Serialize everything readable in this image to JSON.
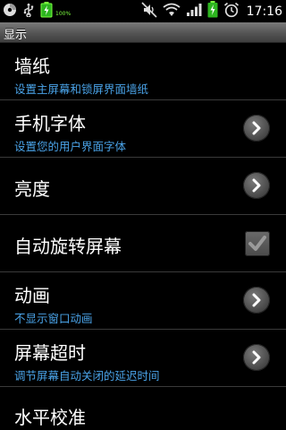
{
  "status_bar": {
    "icons": [
      "disc-icon",
      "usb-icon",
      "battery-charge-icon",
      "mute-icon",
      "wifi-icon",
      "signal-icon",
      "battery-icon",
      "alarm-icon"
    ],
    "battery_label": "100%",
    "time": "17:16"
  },
  "title_bar": {
    "title": "显示"
  },
  "settings": [
    {
      "title": "墙纸",
      "subtitle": "设置主屏幕和锁屏界面墙纸",
      "control": "none"
    },
    {
      "title": "手机字体",
      "subtitle": "设置您的用户界面字体",
      "control": "chevron"
    },
    {
      "title": "亮度",
      "subtitle": "",
      "control": "chevron"
    },
    {
      "title": "自动旋转屏幕",
      "subtitle": "",
      "control": "checkbox",
      "checked": true
    },
    {
      "title": "动画",
      "subtitle": "不显示窗口动画",
      "control": "chevron"
    },
    {
      "title": "屏幕超时",
      "subtitle": "调节屏幕自动关闭的延迟时间",
      "control": "chevron"
    },
    {
      "title": "水平校准",
      "subtitle": "",
      "control": "none"
    }
  ],
  "colors": {
    "subtitle": "#4aa3e8",
    "battery_green": "#7cff3f"
  }
}
